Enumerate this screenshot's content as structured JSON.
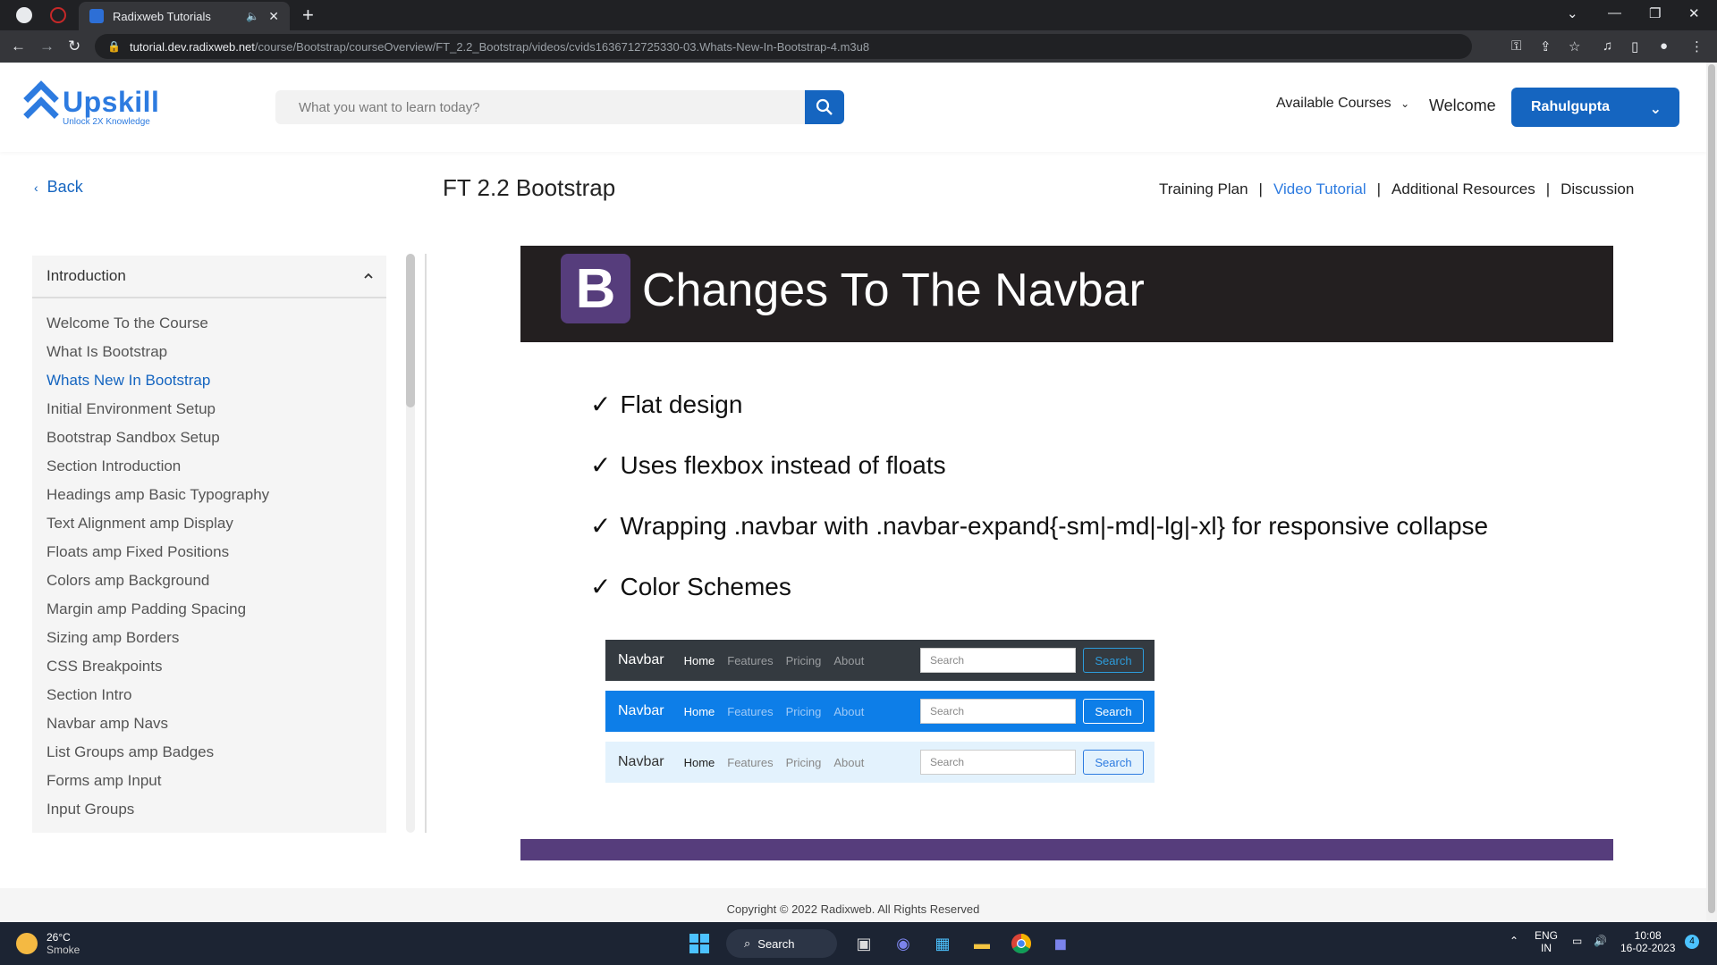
{
  "browser": {
    "tab_title": "Radixweb Tutorials",
    "url_host": "tutorial.dev.radixweb.net",
    "url_path": "/course/Bootstrap/courseOverview/FT_2.2_Bootstrap/videos/cvids1636712725330-03.Whats-New-In-Bootstrap-4.m3u8"
  },
  "header": {
    "logo_name": "Upskill",
    "logo_tagline": "Unlock 2X Knowledge",
    "search_placeholder": "What you want to learn today?",
    "available_courses": "Available Courses",
    "welcome": "Welcome",
    "user_name": "Rahulgupta"
  },
  "course": {
    "back_label": "Back",
    "title": "FT 2.2 Bootstrap",
    "tabs": [
      "Training Plan",
      "Video Tutorial",
      "Additional Resources",
      "Discussion"
    ],
    "active_tab": "Video Tutorial"
  },
  "sidebar": {
    "section_title": "Introduction",
    "items": [
      "Welcome To the Course",
      "What Is Bootstrap",
      "Whats New In Bootstrap",
      "Initial Environment Setup",
      "Bootstrap Sandbox Setup",
      "Section Introduction",
      "Headings amp Basic Typography",
      "Text Alignment amp Display",
      "Floats amp Fixed Positions",
      "Colors amp Background",
      "Margin amp Padding Spacing",
      "Sizing amp Borders",
      "CSS Breakpoints",
      "Section Intro",
      "Navbar amp Navs",
      "List Groups amp Badges",
      "Forms amp Input",
      "Input Groups"
    ],
    "active_item": "Whats New In Bootstrap"
  },
  "slide": {
    "logo_letter": "B",
    "title": "Changes To The Navbar",
    "bullets": [
      "Flat design",
      "Uses flexbox instead of floats",
      "Wrapping .navbar with .navbar-expand{-sm|-md|-lg|-xl} for responsive collapse",
      "Color Schemes"
    ],
    "demo_nav": {
      "brand": "Navbar",
      "links": [
        "Home",
        "Features",
        "Pricing",
        "About"
      ],
      "search_placeholder": "Search",
      "search_button": "Search"
    }
  },
  "footer": {
    "copyright": "Copyright © 2022 Radixweb. All Rights Reserved"
  },
  "taskbar": {
    "temperature": "26°C",
    "weather": "Smoke",
    "search_label": "Search",
    "lang": "ENG",
    "region": "IN",
    "time": "10:08",
    "date": "16-02-2023",
    "notification_count": "4"
  },
  "colors": {
    "brand_blue": "#1565c0",
    "bootstrap_purple": "#563d7c",
    "slide_header_bg": "#231f20"
  }
}
